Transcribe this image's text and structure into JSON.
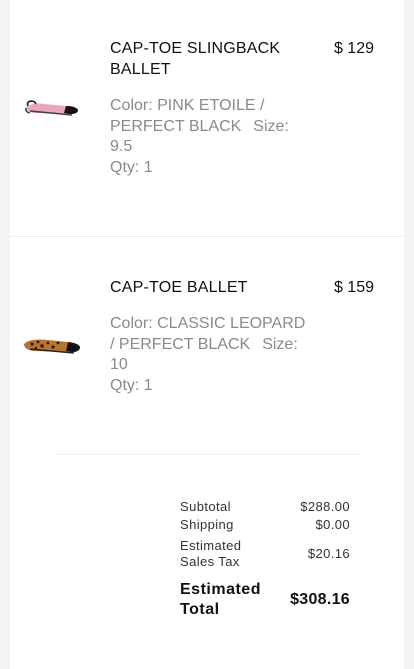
{
  "cart": {
    "items": [
      {
        "name": "CAP-TOE SLINGBACK BALLET",
        "price": "$ 129",
        "color_line": "Color: PINK ETOILE / PERFECT BLACK",
        "size_line": "Size: 9.5",
        "qty_line": "Qty: 1",
        "thumbnail": "pink-slingback-shoe-image"
      },
      {
        "name": "CAP-TOE BALLET",
        "price": "$ 159",
        "color_line": "Color: CLASSIC LEOPARD / PERFECT BLACK",
        "size_line": "Size: 10",
        "qty_line": "Qty: 1",
        "thumbnail": "leopard-ballet-flat-image"
      }
    ]
  },
  "summary": {
    "subtotal_label": "Subtotal",
    "subtotal_value": "$288.00",
    "shipping_label": "Shipping",
    "shipping_value": "$0.00",
    "tax_label": "Estimated Sales Tax",
    "tax_value": "$20.16",
    "total_label": "Estimated Total",
    "total_value": "$308.16"
  },
  "colors": {
    "text_primary": "#111111",
    "text_secondary": "#8a8a8a",
    "background": "#f3f3f3",
    "panel": "#ffffff"
  }
}
